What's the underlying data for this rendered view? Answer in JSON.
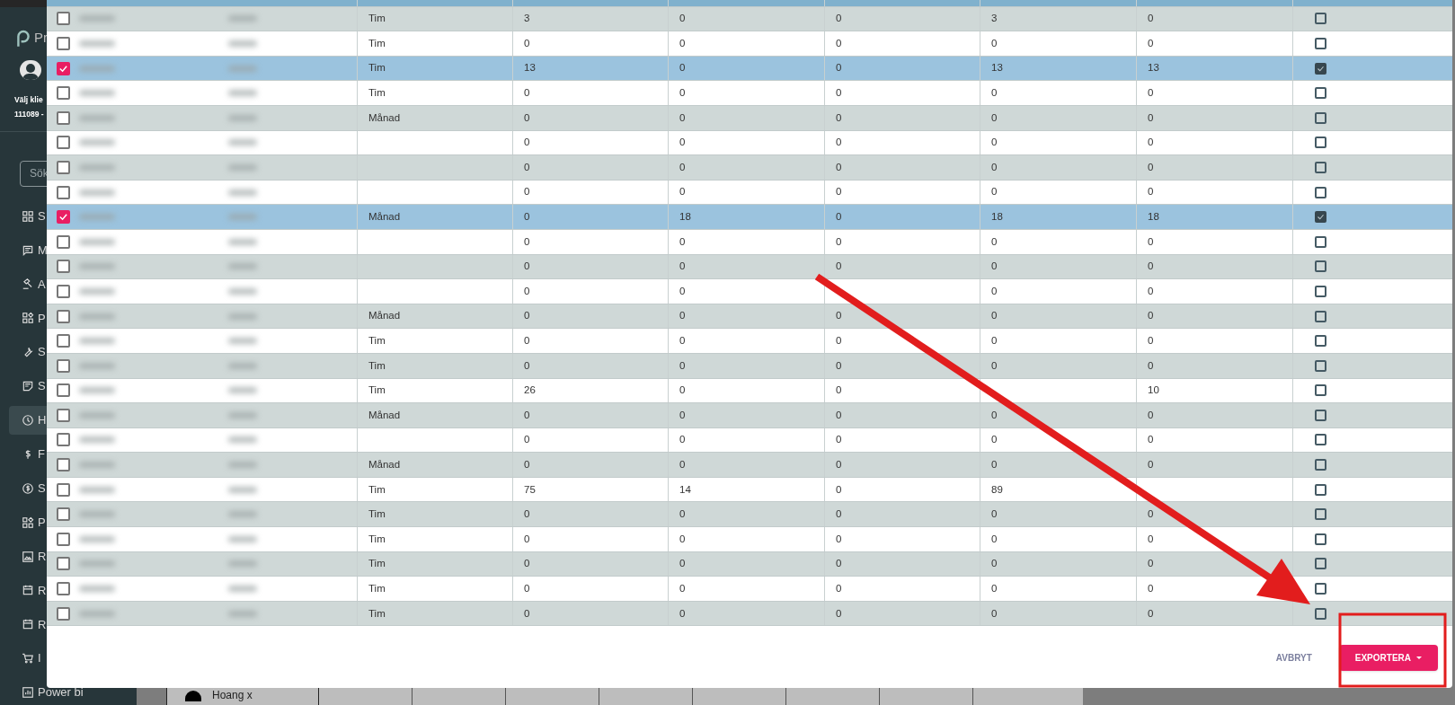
{
  "sidebar": {
    "logo": "Pr",
    "client_label": "Välj klie",
    "client_number": "111089 -",
    "search": {
      "placeholder": "Sök"
    },
    "items": [
      {
        "label": "S",
        "selected": false
      },
      {
        "label": "M",
        "selected": false
      },
      {
        "label": "A",
        "selected": false
      },
      {
        "label": "P",
        "selected": false
      },
      {
        "label": "S",
        "selected": false
      },
      {
        "label": "S",
        "selected": false
      },
      {
        "label": "H",
        "selected": true
      },
      {
        "label": "F",
        "selected": false
      },
      {
        "label": "S",
        "selected": false
      },
      {
        "label": "P",
        "selected": false
      },
      {
        "label": "R",
        "selected": false
      },
      {
        "label": "R",
        "selected": false
      },
      {
        "label": "R",
        "selected": false
      },
      {
        "label": "I",
        "selected": false
      },
      {
        "label": "Power bi",
        "selected": false
      }
    ]
  },
  "background": {
    "row_label": "Hoang x"
  },
  "modal": {
    "rows": [
      {
        "selected": true
      },
      {
        "checked": false,
        "selected": false,
        "flag": false,
        "cells": [
          "Tim",
          "3",
          "0",
          "0",
          "3",
          "0"
        ]
      },
      {
        "checked": false,
        "selected": false,
        "flag": false,
        "cells": [
          "Tim",
          "0",
          "0",
          "0",
          "0",
          "0"
        ]
      },
      {
        "checked": true,
        "selected": true,
        "flag": true,
        "cells": [
          "Tim",
          "13",
          "0",
          "0",
          "13",
          "13"
        ]
      },
      {
        "checked": false,
        "selected": false,
        "flag": false,
        "cells": [
          "Tim",
          "0",
          "0",
          "0",
          "0",
          "0"
        ]
      },
      {
        "checked": false,
        "selected": false,
        "flag": false,
        "cells": [
          "Månad",
          "0",
          "0",
          "0",
          "0",
          "0"
        ]
      },
      {
        "checked": false,
        "selected": false,
        "flag": false,
        "cells": [
          null,
          "0",
          "0",
          "0",
          "0",
          "0"
        ]
      },
      {
        "checked": false,
        "selected": false,
        "flag": false,
        "cells": [
          null,
          "0",
          "0",
          "0",
          "0",
          "0"
        ]
      },
      {
        "checked": false,
        "selected": false,
        "flag": false,
        "cells": [
          null,
          "0",
          "0",
          "0",
          "0",
          "0"
        ]
      },
      {
        "checked": true,
        "selected": true,
        "flag": true,
        "cells": [
          "Månad",
          "0",
          "18",
          "0",
          "18",
          "18"
        ]
      },
      {
        "checked": false,
        "selected": false,
        "flag": false,
        "cells": [
          null,
          "0",
          "0",
          "0",
          "0",
          "0"
        ]
      },
      {
        "checked": false,
        "selected": false,
        "flag": false,
        "cells": [
          null,
          "0",
          "0",
          "0",
          "0",
          "0"
        ]
      },
      {
        "checked": false,
        "selected": false,
        "flag": false,
        "cells": [
          null,
          "0",
          "0",
          null,
          "0",
          "0"
        ]
      },
      {
        "checked": false,
        "selected": false,
        "flag": false,
        "cells": [
          "Månad",
          "0",
          "0",
          "0",
          "0",
          "0"
        ]
      },
      {
        "checked": false,
        "selected": false,
        "flag": false,
        "cells": [
          "Tim",
          "0",
          "0",
          "0",
          "0",
          "0"
        ]
      },
      {
        "checked": false,
        "selected": false,
        "flag": false,
        "cells": [
          "Tim",
          "0",
          "0",
          "0",
          "0",
          "0"
        ]
      },
      {
        "checked": false,
        "selected": false,
        "flag": false,
        "cells": [
          "Tim",
          "26",
          "0",
          "0",
          null,
          "10"
        ]
      },
      {
        "checked": false,
        "selected": false,
        "flag": false,
        "cells": [
          "Månad",
          "0",
          "0",
          "0",
          "0",
          "0"
        ]
      },
      {
        "checked": false,
        "selected": false,
        "flag": false,
        "cells": [
          null,
          "0",
          "0",
          "0",
          "0",
          "0"
        ]
      },
      {
        "checked": false,
        "selected": false,
        "flag": false,
        "cells": [
          "Månad",
          "0",
          "0",
          "0",
          "0",
          "0"
        ]
      },
      {
        "checked": false,
        "selected": false,
        "flag": false,
        "cells": [
          "Tim",
          "75",
          "14",
          "0",
          "89",
          null
        ]
      },
      {
        "checked": false,
        "selected": false,
        "flag": false,
        "cells": [
          "Tim",
          "0",
          "0",
          "0",
          "0",
          "0"
        ]
      },
      {
        "checked": false,
        "selected": false,
        "flag": false,
        "cells": [
          "Tim",
          "0",
          "0",
          "0",
          "0",
          "0"
        ]
      },
      {
        "checked": false,
        "selected": false,
        "flag": false,
        "cells": [
          "Tim",
          "0",
          "0",
          "0",
          "0",
          "0"
        ]
      },
      {
        "checked": false,
        "selected": false,
        "flag": false,
        "cells": [
          "Tim",
          "0",
          "0",
          "0",
          "0",
          "0"
        ]
      },
      {
        "checked": false,
        "selected": false,
        "flag": false,
        "cells": [
          "Tim",
          "0",
          "0",
          "0",
          "0",
          "0"
        ]
      }
    ],
    "buttons": [
      {
        "label": "AVBRYT",
        "kind": "text"
      },
      {
        "label": "EXPORTERA",
        "kind": "primary",
        "dropdown": true
      }
    ]
  }
}
